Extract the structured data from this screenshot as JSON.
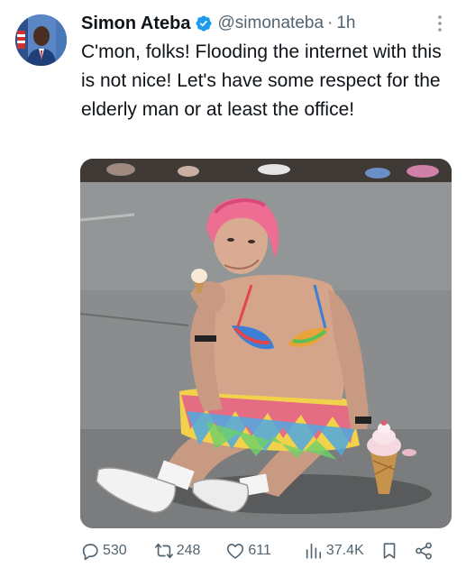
{
  "tweet": {
    "author": {
      "display_name": "Simon Ateba",
      "handle": "@simonateba",
      "verified": true,
      "avatar_icon": "profile-photo"
    },
    "separator": "·",
    "time": "1h",
    "text": "C'mon, folks! Flooding the internet with this is not nice! Let's have some respect for the elderly man or at least the office!",
    "media": {
      "type": "photo",
      "icon": "ai-generated-photo"
    },
    "actions": {
      "replies": "530",
      "reposts": "248",
      "likes": "611",
      "views": "37.4K"
    }
  },
  "colors": {
    "text_primary": "#0f1419",
    "text_secondary": "#536471",
    "verified_blue": "#1d9bf0"
  },
  "icons": {
    "more": "more-dots-icon",
    "reply": "reply-icon",
    "repost": "repost-icon",
    "like": "heart-icon",
    "views": "views-chart-icon",
    "bookmark": "bookmark-icon",
    "share": "share-icon"
  }
}
